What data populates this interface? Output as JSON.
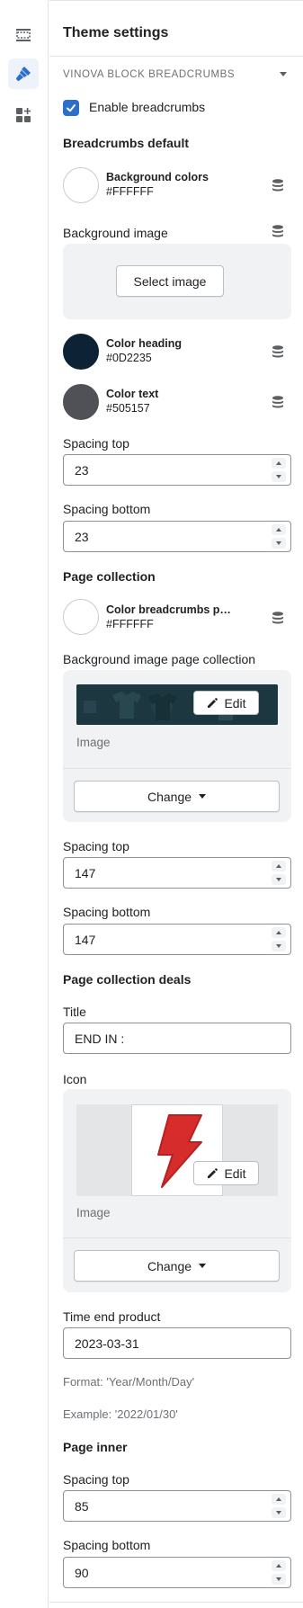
{
  "panel": {
    "title": "Theme settings"
  },
  "section": {
    "name": "VINOVA BLOCK BREADCRUMBS"
  },
  "enable_breadcrumbs": {
    "label": "Enable breadcrumbs",
    "checked": true
  },
  "breadcrumbs_default": {
    "heading": "Breadcrumbs default",
    "background_colors": {
      "label": "Background colors",
      "hex": "#FFFFFF",
      "color": "#FFFFFF"
    },
    "background_image": {
      "label": "Background image",
      "button": "Select image"
    },
    "color_heading": {
      "label": "Color heading",
      "hex": "#0D2235",
      "color": "#0D2235"
    },
    "color_text": {
      "label": "Color text",
      "hex": "#505157",
      "color": "#505157"
    },
    "spacing_top": {
      "label": "Spacing top",
      "value": "23"
    },
    "spacing_bottom": {
      "label": "Spacing bottom",
      "value": "23"
    }
  },
  "page_collection": {
    "heading": "Page collection",
    "color_breadcrumbs": {
      "label": "Color breadcrumbs page c...",
      "hex": "#FFFFFF",
      "color": "#FFFFFF"
    },
    "background_image": {
      "label": "Background image page collection",
      "edit": "Edit",
      "image_caption": "Image",
      "change": "Change"
    },
    "spacing_top": {
      "label": "Spacing top",
      "value": "147"
    },
    "spacing_bottom": {
      "label": "Spacing bottom",
      "value": "147"
    }
  },
  "page_collection_deals": {
    "heading": "Page collection deals",
    "title": {
      "label": "Title",
      "value": "END IN :"
    },
    "icon": {
      "label": "Icon",
      "edit": "Edit",
      "image_caption": "Image",
      "change": "Change"
    },
    "time_end": {
      "label": "Time end product",
      "value": "2023-03-31"
    },
    "format_help": "Format: 'Year/Month/Day'",
    "example_help": "Example: '2022/01/30'"
  },
  "page_inner": {
    "heading": "Page inner",
    "spacing_top": {
      "label": "Spacing top",
      "value": "85"
    },
    "spacing_bottom": {
      "label": "Spacing bottom",
      "value": "90"
    }
  },
  "icons": {
    "rail": [
      "sections-icon",
      "brush-icon",
      "apps-icon"
    ],
    "dynamic_source": "database-icon",
    "pencil": "pencil-icon",
    "lightning": "lightning-icon"
  },
  "colors": {
    "accent": "#2c6ecb",
    "lightning": "#d72c2c"
  }
}
